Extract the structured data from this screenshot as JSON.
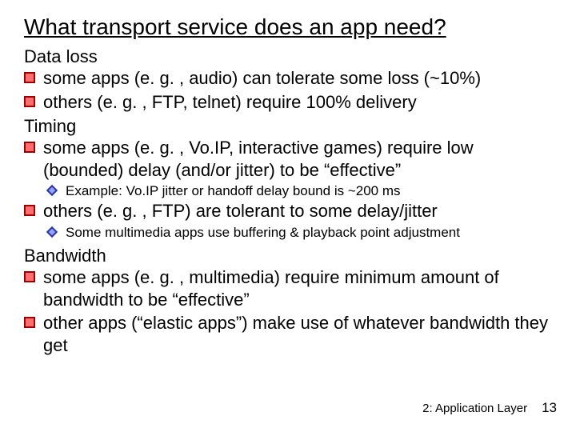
{
  "title": "What transport service does an app need?",
  "sections": {
    "dataloss": {
      "head": "Data loss",
      "b1": "some apps (e. g. , audio) can tolerate some loss (~10%)",
      "b2": "others (e. g. , FTP, telnet) require 100% delivery"
    },
    "timing": {
      "head": "Timing",
      "b1": "some apps (e. g. , Vo.IP, interactive games) require low (bounded) delay (and/or jitter) to be “effective”",
      "s1": "Example: Vo.IP jitter or handoff delay bound is ~200 ms",
      "b2": "others (e. g. , FTP) are tolerant to some delay/jitter",
      "s2": "Some multimedia apps use buffering & playback point adjustment"
    },
    "bandwidth": {
      "head": "Bandwidth",
      "b1": "some apps (e. g. , multimedia) require minimum amount of bandwidth to be “effective”",
      "b2": "other apps (“elastic apps”) make use of whatever bandwidth they get"
    }
  },
  "footer": {
    "chapter": "2: Application Layer",
    "page": "13"
  }
}
